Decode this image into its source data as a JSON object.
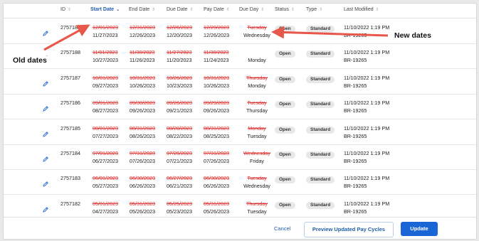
{
  "columns": {
    "id": "ID",
    "start_date": "Start Date",
    "end_date": "End Date",
    "due_date": "Due Date",
    "pay_date": "Pay Date",
    "due_day": "Due Day",
    "status": "Status",
    "type": "Type",
    "last_modified": "Last Modified"
  },
  "rows": [
    {
      "id": "2757189",
      "start_old": "12/01/2023",
      "start_new": "11/27/2023",
      "end_old": "12/31/2023",
      "end_new": "12/26/2023",
      "due_old": "12/26/2023",
      "due_new": "12/20/2023",
      "pay_old": "12/29/2023",
      "pay_new": "12/26/2023",
      "day_old": "Tuesday",
      "day_new": "Wednesday",
      "status": "Open",
      "type": "Standard",
      "modified_date": "11/10/2022 1:19 PM",
      "modified_by": "BR-19265"
    },
    {
      "id": "2757188",
      "start_old": "11/01/2023",
      "start_new": "10/27/2023",
      "end_old": "11/30/2023",
      "end_new": "11/26/2023",
      "due_old": "11/27/2023",
      "due_new": "11/20/2023",
      "pay_old": "11/30/2023",
      "pay_new": "11/24/2023",
      "day_old": "",
      "day_new": "Monday",
      "status": "Open",
      "type": "Standard",
      "modified_date": "11/10/2022 1:19 PM",
      "modified_by": "BR-19265"
    },
    {
      "id": "2757187",
      "start_old": "10/01/2023",
      "start_new": "09/27/2023",
      "end_old": "10/31/2023",
      "end_new": "10/26/2023",
      "due_old": "10/26/2023",
      "due_new": "10/23/2023",
      "pay_old": "10/31/2023",
      "pay_new": "10/26/2023",
      "day_old": "Thursday",
      "day_new": "Monday",
      "status": "Open",
      "type": "Standard",
      "modified_date": "11/10/2022 1:19 PM",
      "modified_by": "BR-19265"
    },
    {
      "id": "2757186",
      "start_old": "09/01/2023",
      "start_new": "08/27/2023",
      "end_old": "09/30/2023",
      "end_new": "09/26/2023",
      "due_old": "09/26/2023",
      "due_new": "09/21/2023",
      "pay_old": "09/29/2023",
      "pay_new": "09/26/2023",
      "day_old": "Tuesday",
      "day_new": "Thursday",
      "status": "Open",
      "type": "Standard",
      "modified_date": "11/10/2022 1:19 PM",
      "modified_by": "BR-19265"
    },
    {
      "id": "2757185",
      "start_old": "08/01/2023",
      "start_new": "07/27/2023",
      "end_old": "08/31/2023",
      "end_new": "08/26/2023",
      "due_old": "08/28/2023",
      "due_new": "08/22/2023",
      "pay_old": "08/31/2023",
      "pay_new": "08/25/2023",
      "day_old": "Monday",
      "day_new": "Tuesday",
      "status": "Open",
      "type": "Standard",
      "modified_date": "11/10/2022 1:19 PM",
      "modified_by": "BR-19265"
    },
    {
      "id": "2757184",
      "start_old": "07/01/2023",
      "start_new": "06/27/2023",
      "end_old": "07/31/2023",
      "end_new": "07/26/2023",
      "due_old": "07/26/2023",
      "due_new": "07/21/2023",
      "pay_old": "07/31/2023",
      "pay_new": "07/26/2023",
      "day_old": "Wednesday",
      "day_new": "Friday",
      "status": "Open",
      "type": "Standard",
      "modified_date": "11/10/2022 1:19 PM",
      "modified_by": "BR-19265"
    },
    {
      "id": "2757183",
      "start_old": "06/01/2023",
      "start_new": "05/27/2023",
      "end_old": "06/30/2023",
      "end_new": "06/26/2023",
      "due_old": "06/27/2023",
      "due_new": "06/21/2023",
      "pay_old": "06/30/2023",
      "pay_new": "06/26/2023",
      "day_old": "Tuesday",
      "day_new": "Wednesday",
      "status": "Open",
      "type": "Standard",
      "modified_date": "11/10/2022 1:19 PM",
      "modified_by": "BR-19265"
    },
    {
      "id": "2757182",
      "start_old": "05/01/2023",
      "start_new": "04/27/2023",
      "end_old": "05/31/2023",
      "end_new": "05/26/2023",
      "due_old": "05/25/2023",
      "due_new": "05/23/2023",
      "pay_old": "05/31/2023",
      "pay_new": "05/26/2023",
      "day_old": "Thursday",
      "day_new": "Tuesday",
      "status": "Open",
      "type": "Standard",
      "modified_date": "11/10/2022 1:19 PM",
      "modified_by": "BR-19265"
    }
  ],
  "footer": {
    "cancel": "Cancel",
    "preview": "Preview Updated Pay Cycles",
    "update": "Update"
  },
  "annotations": {
    "old_dates": "Old dates",
    "new_dates": "New dates"
  },
  "colors": {
    "accent": "#1a66d6",
    "old_date": "#e03030",
    "annotation_arrow": "#e8574a"
  },
  "icons": {
    "edit": "pencil-icon",
    "sort": "sort-arrows-icon",
    "sort_active": "chevron-down-icon"
  }
}
